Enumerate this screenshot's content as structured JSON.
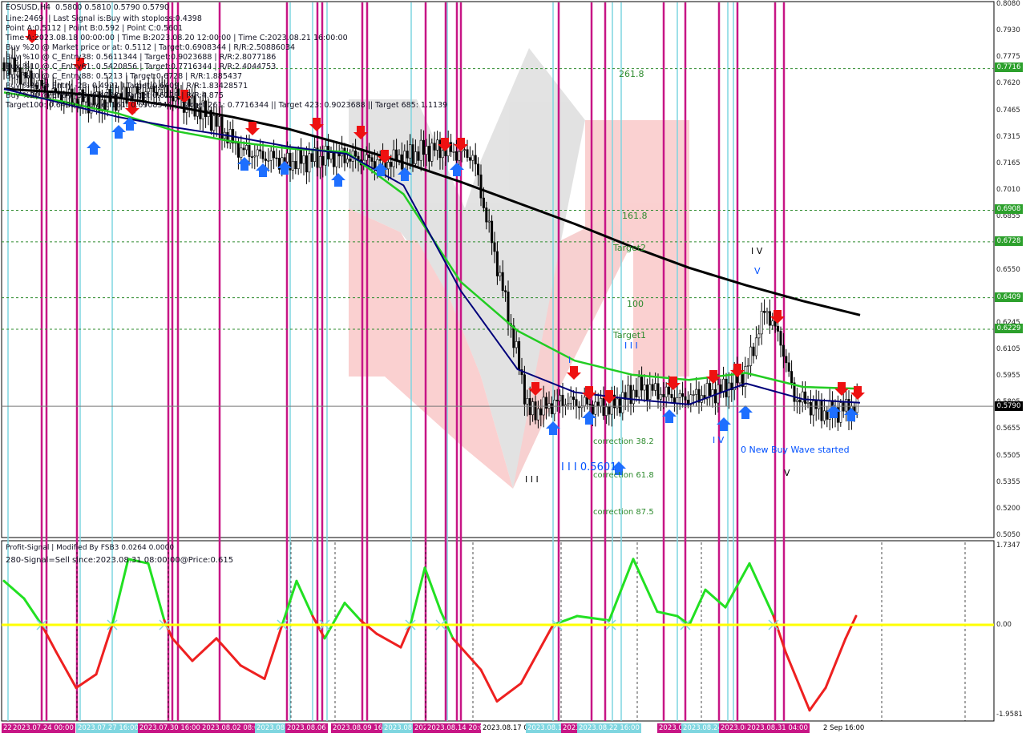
{
  "header": {
    "symbol_line": "EOSUSD,H4  0.5800 0.5810 0.5790 0.5790",
    "info_lines": [
      "Line:2469  | Last Signal is:Buy with stoploss:0.4398",
      "Point A:0.5112 | Point B:0.592 | Point C:0.5601",
      "Time A:2023.08.18 00:00:00 | Time B:2023.08.20 12:00:00 | Time C:2023.08.21 16:00:00",
      "Buy %20 @ Market price or at: 0.5112 | Target:0.6908344 | R/R:2.50886034",
      "Buy %10 @ C_Entry38: 0.5611344 | Target:0.9023688 | R/R:2.8077186",
      "Buy %10 @ C_Entry61: 0.5420856 | Target:0.7716344 | R/R:2.4044753",
      "Buy %10 @ C_Entry88: 0.5213 | Target:0.6728 | R/R:1.885437",
      "Buy %20 @ Entry -23: 0.4921 | Target:0.6409 | R/R:1.83428571",
      "Buy %20 @ Entry -50: 0.4708 | Target:0.6229 | R/R:4.875",
      "Target100: 0.6409 || Target 161: 0.6908344 || Target 261: 0.7716344 || Target 423: 0.9023688 || Target 685: 1.1139"
    ]
  },
  "price_axis": {
    "labels": [
      "0.8080",
      "0.7930",
      "0.7775",
      "0.7620",
      "0.7465",
      "0.7315",
      "0.7165",
      "0.7010",
      "0.6855",
      "0.6700",
      "0.6550",
      "0.6395",
      "0.6245",
      "0.6105",
      "0.5955",
      "0.5805",
      "0.5655",
      "0.5505",
      "0.5355",
      "0.5200",
      "0.5050"
    ],
    "current_price": "0.5790",
    "level_tags": [
      {
        "label": "0.7716",
        "color": "#2ca02c"
      },
      {
        "label": "0.6908",
        "color": "#2ca02c"
      },
      {
        "label": "0.6728",
        "color": "#2ca02c"
      },
      {
        "label": "0.6409",
        "color": "#2ca02c"
      },
      {
        "label": "0.6229",
        "color": "#2ca02c"
      }
    ]
  },
  "levels": [
    {
      "label": "261.8",
      "price": 0.7716
    },
    {
      "label": "161.8",
      "price": 0.6908
    },
    {
      "label": "Target2",
      "price": 0.6728
    },
    {
      "label": "100",
      "price": 0.6409
    },
    {
      "label": "Target1",
      "price": 0.6229
    }
  ],
  "annotations": {
    "wave_labels": [
      "I V",
      "V",
      "I",
      "I I I",
      "I V",
      "I I I",
      "V",
      "I I I"
    ],
    "correction_38": "correction 38.2",
    "correction_61": "correction 61.8",
    "correction_87": "correction 87.5",
    "point_label": "I I I 0.5601",
    "buy_wave": "0 New Buy Wave started",
    "wave_bottom": "V"
  },
  "indicator": {
    "title": "Profit-Signal | Modified By FSB3 0.0264 0.0000",
    "signal": "280-Signal=Sell since:2023.08.31 08:00:00@Price:0.615",
    "axis_labels": [
      "1.7347",
      "0.00",
      "-1.9581"
    ]
  },
  "time_axis": {
    "labels": [
      {
        "text": "22 Jul 2023",
        "bg": "#c71585"
      },
      {
        "text": "2023.07.24 00:00",
        "bg": "#c71585"
      },
      {
        "text": "2023.07.27 16:00",
        "bg": "#7fd6e0"
      },
      {
        "text": "2023.07.30 16:00",
        "bg": "#c71585"
      },
      {
        "text": "2023.08.02 08:00",
        "bg": "#c71585"
      },
      {
        "text": "2023.08.05",
        "bg": "#7fd6e0"
      },
      {
        "text": "2023.08.06",
        "bg": "#c71585"
      },
      {
        "text": "2023.08.09 16:00",
        "bg": "#c71585"
      },
      {
        "text": "2023.08.11",
        "bg": "#7fd6e0"
      },
      {
        "text": "2023.08.12",
        "bg": "#c71585"
      },
      {
        "text": "2023.08.14 20:00",
        "bg": "#c71585"
      },
      {
        "text": "2023.08.17 00:00",
        "bg": "#ffffff"
      },
      {
        "text": "2023.08.19",
        "bg": "#7fd6e0"
      },
      {
        "text": "2023.08.20",
        "bg": "#c71585"
      },
      {
        "text": "2023.08.22 16:00",
        "bg": "#7fd6e0"
      },
      {
        "text": "2023.08.23",
        "bg": "#c71585"
      },
      {
        "text": "2023.08.24",
        "bg": "#7fd6e0"
      },
      {
        "text": "2023.08.25",
        "bg": "#c71585"
      },
      {
        "text": "2023.08.31 04:00",
        "bg": "#c71585"
      },
      {
        "text": "2 Sep 16:00",
        "bg": "#ffffff"
      }
    ]
  },
  "colors": {
    "magenta": "#c71585",
    "cyan": "#7fd6e0",
    "ma_green": "#22cc22",
    "ma_navy": "#00007a",
    "ma_black": "#000000",
    "level": "#2e8b2e",
    "osc_up": "#22e022",
    "osc_dn": "#ee2020",
    "zero": "#ffff00"
  },
  "chart_data": {
    "type": "candlestick",
    "title": "EOSUSD,H4",
    "ylim": [
      0.505,
      0.808
    ],
    "oscillator_ylim": [
      -1.9581,
      1.7347
    ],
    "series": [
      {
        "name": "MA black",
        "values": [
          0.76,
          0.758,
          0.755,
          0.75,
          0.744,
          0.737,
          0.728,
          0.718,
          0.707,
          0.695,
          0.683,
          0.67,
          0.658,
          0.648,
          0.639,
          0.631
        ]
      },
      {
        "name": "MA green",
        "values": [
          0.758,
          0.753,
          0.746,
          0.736,
          0.73,
          0.726,
          0.724,
          0.7,
          0.65,
          0.622,
          0.605,
          0.597,
          0.594,
          0.598,
          0.59,
          0.589
        ]
      },
      {
        "name": "MA navy",
        "values": [
          0.76,
          0.752,
          0.744,
          0.738,
          0.733,
          0.727,
          0.723,
          0.705,
          0.645,
          0.6,
          0.587,
          0.583,
          0.58,
          0.592,
          0.583,
          0.581
        ]
      }
    ],
    "levels": [
      0.7716,
      0.6908,
      0.6728,
      0.6409,
      0.6229
    ],
    "last_price": 0.579
  }
}
